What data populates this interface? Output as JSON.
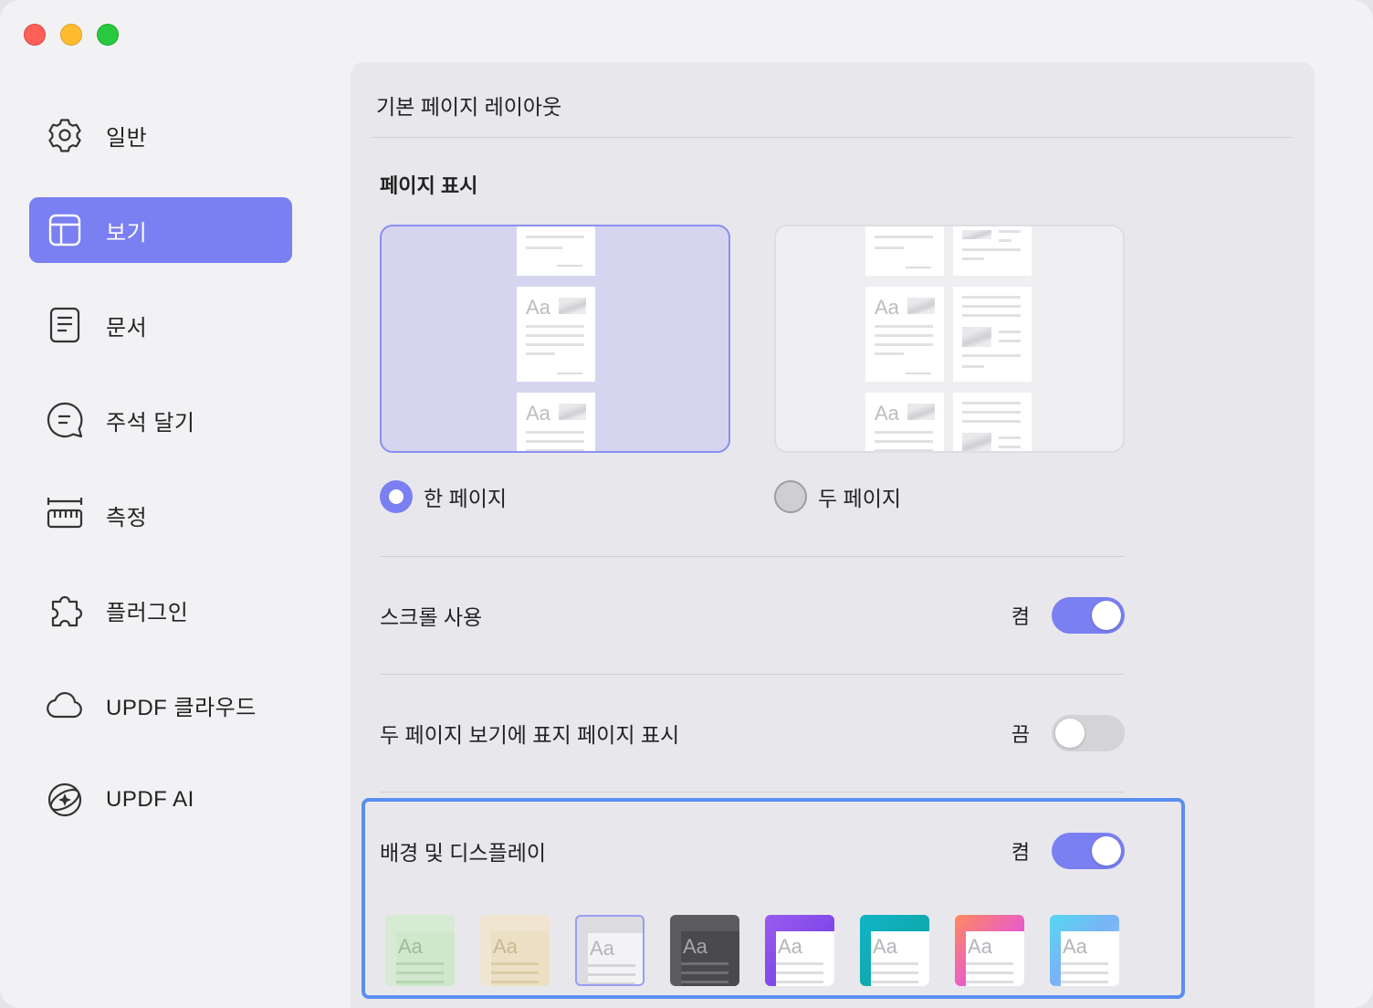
{
  "window": {
    "traffic_lights": [
      "close",
      "minimize",
      "zoom"
    ]
  },
  "sidebar": {
    "items": [
      {
        "label": "일반",
        "icon": "gear-icon",
        "active": false
      },
      {
        "label": "보기",
        "icon": "layout-icon",
        "active": true
      },
      {
        "label": "문서",
        "icon": "document-icon",
        "active": false
      },
      {
        "label": "주석 달기",
        "icon": "comment-icon",
        "active": false
      },
      {
        "label": "측정",
        "icon": "ruler-icon",
        "active": false
      },
      {
        "label": "플러그인",
        "icon": "puzzle-icon",
        "active": false
      },
      {
        "label": "UPDF 클라우드",
        "icon": "cloud-icon",
        "active": false
      },
      {
        "label": "UPDF AI",
        "icon": "ai-sparkle-icon",
        "active": false
      }
    ]
  },
  "main": {
    "title": "기본 페이지 레이아웃",
    "page_display": {
      "title": "페이지 표시",
      "options": [
        {
          "label": "한 페이지",
          "selected": true
        },
        {
          "label": "두 페이지",
          "selected": false
        }
      ],
      "thumb_text": "Aa"
    },
    "settings": [
      {
        "label": "스크롤 사용",
        "state": "켬",
        "on": true
      },
      {
        "label": "두 페이지 보기에 표지 페이지 표시",
        "state": "끔",
        "on": false
      },
      {
        "label": "배경 및 디스플레이",
        "state": "켬",
        "on": true
      }
    ],
    "themes": {
      "thumb_text": "Aa",
      "selected_index": 2,
      "items": [
        "green",
        "beige",
        "light-gray",
        "dark-gray",
        "purple",
        "teal",
        "gradient-pink",
        "gradient-blue"
      ]
    }
  },
  "colors": {
    "accent": "#7a7ff2",
    "highlight_border": "#5b8ef0",
    "active_sidebar": "#7a7ff2"
  }
}
